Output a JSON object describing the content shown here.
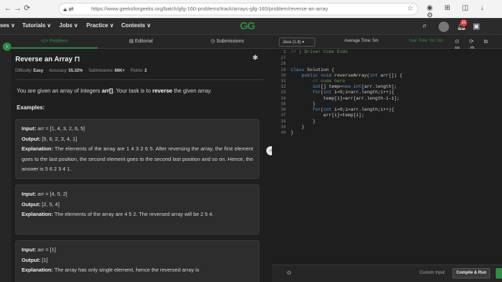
{
  "browser": {
    "url": "https://www.geeksforgeeks.org/batch/gfg-160-problems/track/arrays-gfg-160/problem/reverse-an-array"
  },
  "topnav": {
    "items": [
      "ses ∨",
      "Tutorials ∨",
      "Jobs ∨",
      "Practice ∨",
      "Contests ∨"
    ],
    "notification_count": "10"
  },
  "tabs": [
    "Problem",
    "Editorial",
    "Submissions"
  ],
  "problem": {
    "title": "Reverse an Array",
    "difficulty_label": "Difficulty:",
    "difficulty": "Easy",
    "accuracy_label": "Accuracy:",
    "accuracy": "55.32%",
    "submissions_label": "Submissions:",
    "submissions": "66K+",
    "points_label": "Points:",
    "points": "2",
    "desc_pre": "You are given an array of integers ",
    "desc_arr": "arr[]",
    "desc_mid": ". Your task is to ",
    "desc_rev": "reverse",
    "desc_post": " the given array.",
    "examples_label": "Examples:",
    "examples": [
      {
        "input_label": "Input:",
        "input": " arr = [1, 4, 3, 2, 6, 5]",
        "output_label": "Output:",
        "output": " [5, 6, 2, 3, 4, 1]",
        "expl_label": "Explanation:",
        "expl": " The elements of the array are 1 4 3 2 6 5. After reversing the array, the first element goes to the last position, the second element goes to the second last position and so on. Hence, the answer is 5 6 2 3 4 1."
      },
      {
        "input_label": "Input:",
        "input": " arr = [4, 5, 2]",
        "output_label": "Output:",
        "output": " [2, 5, 4]",
        "expl_label": "Explanation:",
        "expl": " The elements of the array are 4 5 2. The reversed array will be 2 5 4."
      },
      {
        "input_label": "Input:",
        "input": " arr = [1]",
        "output_label": "Output:",
        "output": " [1]",
        "expl_label": "Explanation:",
        "expl": " The array has only single element, hence the reversed array is"
      }
    ]
  },
  "editor": {
    "language": "Java (1.8)",
    "avg_time": "Average Time: 5m",
    "your_time": "Your Time: 0m 26s",
    "lines": [
      {
        "n": "1",
        "t": "// } Driver Code Ends"
      },
      {
        "n": "27",
        "t": ""
      },
      {
        "n": "28",
        "t": ""
      },
      {
        "n": "29",
        "t": "class Solution {"
      },
      {
        "n": "30",
        "t": "    public void reverseArray(int arr[]) {"
      },
      {
        "n": "31",
        "t": "        // code here"
      },
      {
        "n": "32",
        "t": "        int[] temp=new int[arr.length];"
      },
      {
        "n": "33",
        "t": "        for(int i=0;i<arr.length;i++){"
      },
      {
        "n": "34",
        "t": "            temp[i]=arr[arr.length-i-1];"
      },
      {
        "n": "35",
        "t": "        }"
      },
      {
        "n": "36",
        "t": "        for(int i=0;i<arr.length;i++){"
      },
      {
        "n": "37",
        "t": "            arr[i]=temp[i];"
      },
      {
        "n": "38",
        "t": "        }"
      },
      {
        "n": "39",
        "t": "    }"
      },
      {
        "n": "40",
        "t": "}"
      }
    ],
    "custom_input": "Custom Input",
    "compile_run": "Compile & Run"
  },
  "colors": {
    "accent": "#2f8d46",
    "background": "#1e1e1e"
  }
}
